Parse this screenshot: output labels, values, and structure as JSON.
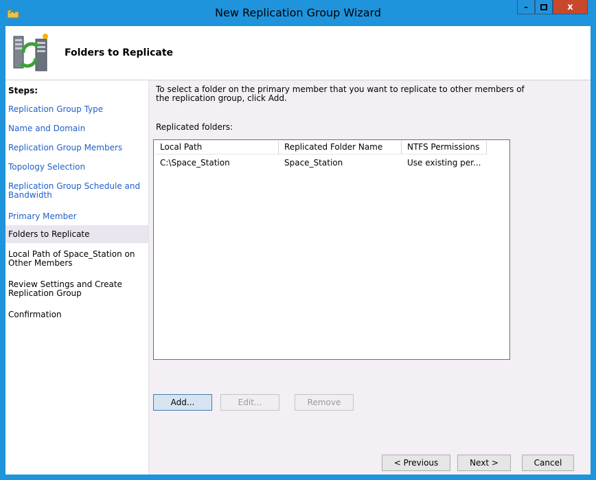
{
  "window": {
    "title": "New Replication Group Wizard",
    "icon": "folder-icon",
    "minimize_glyph": "–",
    "close_glyph": "x"
  },
  "header": {
    "title": "Folders to Replicate",
    "icon": "server-replication-icon"
  },
  "steps": {
    "title": "Steps:",
    "items": [
      {
        "label": "Replication Group Type",
        "state": "link"
      },
      {
        "label": "Name and Domain",
        "state": "link"
      },
      {
        "label": "Replication Group Members",
        "state": "link"
      },
      {
        "label": "Topology Selection",
        "state": "link"
      },
      {
        "label": "Replication Group Schedule and Bandwidth",
        "state": "link"
      },
      {
        "label": "Primary Member",
        "state": "link"
      },
      {
        "label": "Folders to Replicate",
        "state": "current"
      },
      {
        "label": "Local Path of Space_Station on Other Members",
        "state": "plain"
      },
      {
        "label": "Review Settings and Create Replication Group",
        "state": "plain"
      },
      {
        "label": "Confirmation",
        "state": "plain"
      }
    ]
  },
  "main": {
    "description": "To select a folder on the primary member that you want to replicate to other members of the replication group, click Add.",
    "replicated_folders_label": "Replicated folders:",
    "table": {
      "columns": [
        "Local Path",
        "Replicated Folder Name",
        "NTFS Permissions"
      ],
      "rows": [
        [
          "C:\\Space_Station",
          "Space_Station",
          "Use existing per..."
        ]
      ]
    },
    "buttons": {
      "add": "Add...",
      "edit": "Edit...",
      "remove": "Remove"
    }
  },
  "footer": {
    "previous": "< Previous",
    "next": "Next >",
    "cancel": "Cancel"
  },
  "colors": {
    "frame": "#1f94dc",
    "link": "#1f5fc9",
    "panel": "#f3eff5",
    "close_button": "#c9482c"
  }
}
